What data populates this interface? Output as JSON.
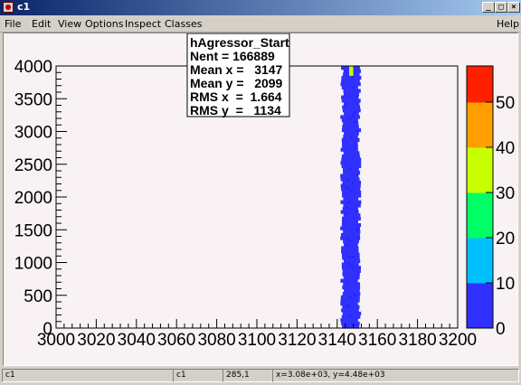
{
  "window": {
    "title": "c1",
    "buttons": [
      "_",
      "□",
      "×"
    ]
  },
  "menu": {
    "items": [
      "File",
      "Edit",
      "View",
      "Options",
      "Inspect",
      "Classes"
    ],
    "help": "Help"
  },
  "stats": {
    "lines": [
      "hAgressor_Start",
      "Nent = 166889",
      "Mean x =   3147",
      "Mean y =   2099",
      "RMS x  =  1.664",
      "RMS y  =   1134"
    ]
  },
  "chart_data": {
    "type": "heatmap",
    "title": "",
    "xlabel": "",
    "ylabel": "",
    "x_tick_labels": [
      "3000",
      "3020",
      "3040",
      "3060",
      "3080",
      "3100",
      "3120",
      "3140",
      "3160",
      "3180",
      "3200"
    ],
    "y_tick_labels": [
      "0",
      "500",
      "1000",
      "1500",
      "2000",
      "2500",
      "3000",
      "3500",
      "4000"
    ],
    "xlim": [
      3000,
      3200
    ],
    "ylim": [
      0,
      4000
    ],
    "z_tick_labels": [
      "0",
      "10",
      "20",
      "30",
      "40",
      "50"
    ],
    "zlim": [
      0,
      58
    ],
    "band": {
      "x_range": [
        3141.5,
        3152
      ],
      "y_range": [
        0,
        4000
      ],
      "typical_z": 3,
      "hotspot": {
        "x": [
          3146,
          3148
        ],
        "y": [
          3850,
          4000
        ],
        "z": 40
      }
    }
  },
  "status": {
    "cells": [
      "c1",
      "c1",
      "285,1",
      "x=3.08e+03, y=4.48e+03"
    ]
  }
}
